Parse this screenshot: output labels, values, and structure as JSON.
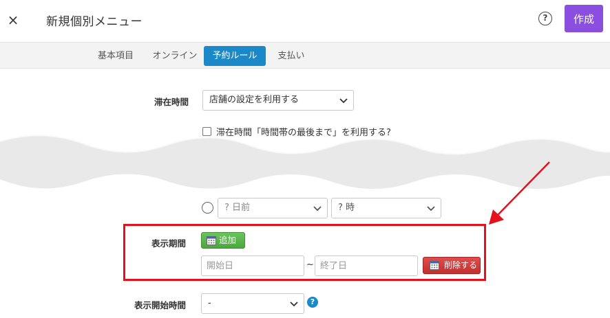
{
  "header": {
    "close_glyph": "×",
    "title": "新規個別メニュー",
    "help_glyph": "?",
    "create_label": "作成",
    "accent": "#8b4fe0"
  },
  "tabs": [
    {
      "label": "基本項目",
      "active": false
    },
    {
      "label": "オンライン",
      "active": false
    },
    {
      "label": "予約ルール",
      "active": true
    },
    {
      "label": "支払い",
      "active": false
    }
  ],
  "form": {
    "stay_time": {
      "label": "滞在時間",
      "selected": "店舗の設定を利用する",
      "checkbox_label": "滞在時間「時間帯の最後まで」を利用する?",
      "checked": false
    },
    "partial_selects": {
      "days_before": "? 日前",
      "hour": "? 時"
    },
    "display_period": {
      "label": "表示期間",
      "add_label": "追加",
      "start_placeholder": "開始日",
      "separator": "~",
      "end_placeholder": "終了日",
      "delete_label": "削除する"
    },
    "display_start_time": {
      "label": "表示開始時間",
      "selected": "-",
      "help_glyph": "?"
    }
  },
  "colors": {
    "tab_active": "#1b88c8",
    "highlight_box": "#e5101a",
    "add_button": "#4aa83d",
    "delete_button": "#c42f2f"
  }
}
